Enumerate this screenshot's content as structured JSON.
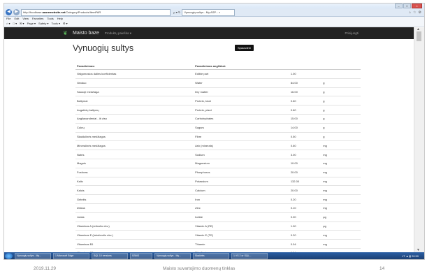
{
  "browser": {
    "url_prefix": "http://foodbase.",
    "url_domain": "azuremebsite.net",
    "url_path": "/Category/Products/ItemPAR",
    "address_controls": "℘ ▾ ↻",
    "tab_title": "Vynuogių sultys - My ASP...",
    "tab_close": "×",
    "menu_items": [
      "File",
      "Edit",
      "View",
      "Favorites",
      "Tools",
      "Help"
    ],
    "command_items": [
      "⌂ ▾",
      "□ ▾",
      "✉ ▾",
      "Page ▾",
      "Safety ▾",
      "Tools ▾",
      "⚙ ▾"
    ],
    "right_icons": [
      "⌂",
      "☆",
      "⚙"
    ],
    "window_buttons": [
      "–",
      "□",
      "×"
    ]
  },
  "site": {
    "brand": "Maisto baze",
    "menu": "Produktų paieška ▾",
    "login": "Prisijungti",
    "tooltip": "Spausdinti"
  },
  "page": {
    "title": "Vynuogių sultys"
  },
  "table": {
    "headers": [
      "Pavadinimas:",
      "Pavadinimas angliškai:",
      "",
      ""
    ],
    "rows": [
      [
        "Valgomosios dalies koeficientas",
        "Edible part",
        "1.00",
        ""
      ],
      [
        "Vanduo",
        "Water",
        "84.00",
        "g"
      ],
      [
        "Sausoji medžiaga",
        "Dry matter",
        "16.00",
        "g"
      ],
      [
        "Baltymai",
        "Protein, total",
        "0.60",
        "g"
      ],
      [
        "Augalinių baltymų",
        "Protein, plant",
        "0.60",
        "g"
      ],
      [
        "Angliavandeniai - iš viso",
        "Carbohydrates",
        "15.00",
        "g"
      ],
      [
        "Cukrų",
        "Sugars",
        "14.00",
        "g"
      ],
      [
        "Skaidulinės medžiagos",
        "Fibre",
        "0.50",
        "g"
      ],
      [
        "Mineralinės medžiagos",
        "Ash (minerals)",
        "0.60",
        "mg"
      ],
      [
        "Natris",
        "Sodium",
        "3.00",
        "mg"
      ],
      [
        "Magnis",
        "Magnesium",
        "10.00",
        "mg"
      ],
      [
        "Fosforas",
        "Phosphorus",
        "20.00",
        "mg"
      ],
      [
        "Kalis",
        "Potassium",
        "132.00",
        "mg"
      ],
      [
        "Kalcis",
        "Calcium",
        "20.00",
        "mg"
      ],
      [
        "Geležis",
        "Iron",
        "0.20",
        "mg"
      ],
      [
        "Zinkas",
        "Zinc",
        "0.10",
        "mg"
      ],
      [
        "Jodas",
        "Iodide",
        "0.00",
        "µg"
      ],
      [
        "Vitaminas A (retinolio ekv.)",
        "Vitamin A (RE)",
        "1.00",
        "µg"
      ],
      [
        "Vitaminas E (tokoferolio ekv.)",
        "Vitamin E (TE)",
        "0.20",
        "mg"
      ],
      [
        "Vitaminas B1",
        "Thiamin",
        "0.04",
        "mg"
      ],
      [
        "Vitaminas B2",
        "Riboflavin",
        "0.04",
        "mg"
      ]
    ]
  },
  "taskbar": {
    "items": [
      "Vynuogių sultys - My...",
      "1 Microsoft Edge",
      "SQL 10 versions",
      "SSMS",
      "Vynuogių sultys - My...",
      "Skaidrės",
      "1 VS 2 or SQL..."
    ],
    "tray": "LT  ▲  ▮  20:50"
  },
  "footer": {
    "date": "2019.11.29",
    "center": "Maisto suvartojimo duomenų tinklas",
    "page_number": "14"
  }
}
